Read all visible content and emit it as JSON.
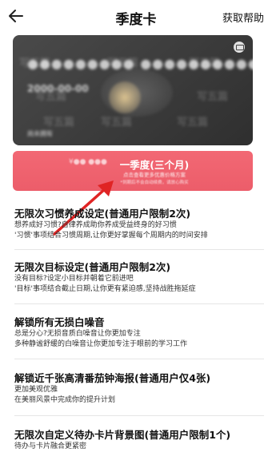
{
  "header": {
    "title": "季度卡",
    "help_label": "获取帮助"
  },
  "card": {
    "owner_label": "尚未拥有",
    "date_label": "2000-00-00",
    "watermark": "写五篇"
  },
  "plan": {
    "name": "一季度(三个月)",
    "subtitle": "点击查看更多优惠价格方案",
    "note": "*到期后不会自动续费，请放心购买"
  },
  "features": [
    {
      "title": "无限次习惯养成设定(普通用户限制2次)",
      "desc": [
        "想养成好习惯?自律养成助你养成受益终身的好习惯",
        "'习惯'事项结合习惯周期,让你更好掌握每个周期内的时间安排"
      ]
    },
    {
      "title": "无限次目标设定(普通用户限制2次)",
      "desc": [
        "没有目标?设定小目标并朝着它前进吧",
        "'目标'事项结合截止日期,让你更有紧迫感,坚持战胜拖延症"
      ]
    },
    {
      "title": "解锁所有无损白噪音",
      "desc": [
        "总是分心?无损音质白噪音让你更加专注",
        "多种静谧舒缓的白噪音让你更加专注于眼前的学习工作"
      ]
    },
    {
      "title": "解锁近千张高清番茄钟海报(普通用户仅4张)",
      "desc": [
        "更加美观优雅",
        "在美丽风景中完成你的提升计划"
      ]
    },
    {
      "title": "无限次自定义待办卡片背景图(普通用户限制1个)",
      "desc": [
        "待办与卡片融合更紧密"
      ]
    }
  ]
}
